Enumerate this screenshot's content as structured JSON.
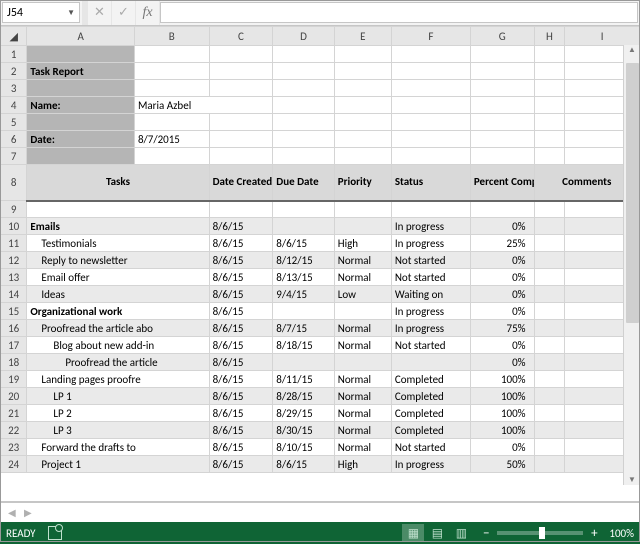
{
  "nameBox": "J54",
  "columnLetters": [
    "A",
    "B",
    "C",
    "D",
    "E",
    "F",
    "G",
    "H",
    "I"
  ],
  "rowNumbers": [
    1,
    2,
    3,
    4,
    5,
    6,
    7,
    8,
    9,
    10,
    11,
    12,
    13,
    14,
    15,
    16,
    17,
    18,
    19,
    20,
    21,
    22,
    23,
    24
  ],
  "report": {
    "title": "Task Report",
    "nameLabel": "Name:",
    "nameValue": "Maria Azbel",
    "dateLabel": "Date:",
    "dateValue": "8/7/2015"
  },
  "headers": {
    "tasks": "Tasks",
    "created": "Date Created",
    "due": "Due Date",
    "priority": "Priority",
    "status": "Status",
    "percent": "Percent Complete",
    "comments": "Comments"
  },
  "rows": [
    {
      "n": 10,
      "alt": true,
      "indent": 0,
      "bold": true,
      "task": "Emails",
      "created": "8/6/15",
      "due": "",
      "priority": "",
      "status": "In progress",
      "pct": "0%"
    },
    {
      "n": 11,
      "alt": false,
      "indent": 1,
      "bold": false,
      "task": "Testimonials",
      "created": "8/6/15",
      "due": "8/6/15",
      "priority": "High",
      "status": "In progress",
      "pct": "25%"
    },
    {
      "n": 12,
      "alt": true,
      "indent": 1,
      "bold": false,
      "task": "Reply to newsletter",
      "created": "8/6/15",
      "due": "8/12/15",
      "priority": "Normal",
      "status": "Not started",
      "pct": "0%"
    },
    {
      "n": 13,
      "alt": false,
      "indent": 1,
      "bold": false,
      "task": "Email offer",
      "created": "8/6/15",
      "due": "8/13/15",
      "priority": "Normal",
      "status": "Not started",
      "pct": "0%"
    },
    {
      "n": 14,
      "alt": true,
      "indent": 1,
      "bold": false,
      "task": "Ideas",
      "created": "8/6/15",
      "due": "9/4/15",
      "priority": "Low",
      "status": "Waiting on",
      "pct": "0%"
    },
    {
      "n": 15,
      "alt": false,
      "indent": 0,
      "bold": true,
      "task": "Organizational work",
      "created": "8/6/15",
      "due": "",
      "priority": "",
      "status": "In progress",
      "pct": "0%"
    },
    {
      "n": 16,
      "alt": true,
      "indent": 1,
      "bold": false,
      "task": "Proofread the article abo",
      "created": "8/6/15",
      "due": "8/7/15",
      "priority": "Normal",
      "status": "In progress",
      "pct": "75%"
    },
    {
      "n": 17,
      "alt": false,
      "indent": 2,
      "bold": false,
      "task": "Blog about new add-in",
      "created": "8/6/15",
      "due": "8/18/15",
      "priority": "Normal",
      "status": "Not started",
      "pct": "0%"
    },
    {
      "n": 18,
      "alt": true,
      "indent": 3,
      "bold": false,
      "task": "Proofread the article",
      "created": "8/6/15",
      "due": "",
      "priority": "",
      "status": "",
      "pct": "0%"
    },
    {
      "n": 19,
      "alt": false,
      "indent": 1,
      "bold": false,
      "task": "Landing pages proofre",
      "created": "8/6/15",
      "due": "8/11/15",
      "priority": "Normal",
      "status": "Completed",
      "pct": "100%"
    },
    {
      "n": 20,
      "alt": true,
      "indent": 2,
      "bold": false,
      "task": "LP 1",
      "created": "8/6/15",
      "due": "8/28/15",
      "priority": "Normal",
      "status": "Completed",
      "pct": "100%"
    },
    {
      "n": 21,
      "alt": false,
      "indent": 2,
      "bold": false,
      "task": "LP 2",
      "created": "8/6/15",
      "due": "8/29/15",
      "priority": "Normal",
      "status": "Completed",
      "pct": "100%"
    },
    {
      "n": 22,
      "alt": true,
      "indent": 2,
      "bold": false,
      "task": "LP 3",
      "created": "8/6/15",
      "due": "8/30/15",
      "priority": "Normal",
      "status": "Completed",
      "pct": "100%"
    },
    {
      "n": 23,
      "alt": false,
      "indent": 1,
      "bold": false,
      "task": "Forward the drafts to ",
      "created": "8/6/15",
      "due": "8/10/15",
      "priority": "Normal",
      "status": "Not started",
      "pct": "0%"
    },
    {
      "n": 24,
      "alt": true,
      "indent": 1,
      "bold": false,
      "task": "Project 1",
      "created": "8/6/15",
      "due": "8/6/15",
      "priority": "High",
      "status": "In progress",
      "pct": "50%"
    }
  ],
  "statusBar": {
    "ready": "READY",
    "zoom": "100%"
  }
}
